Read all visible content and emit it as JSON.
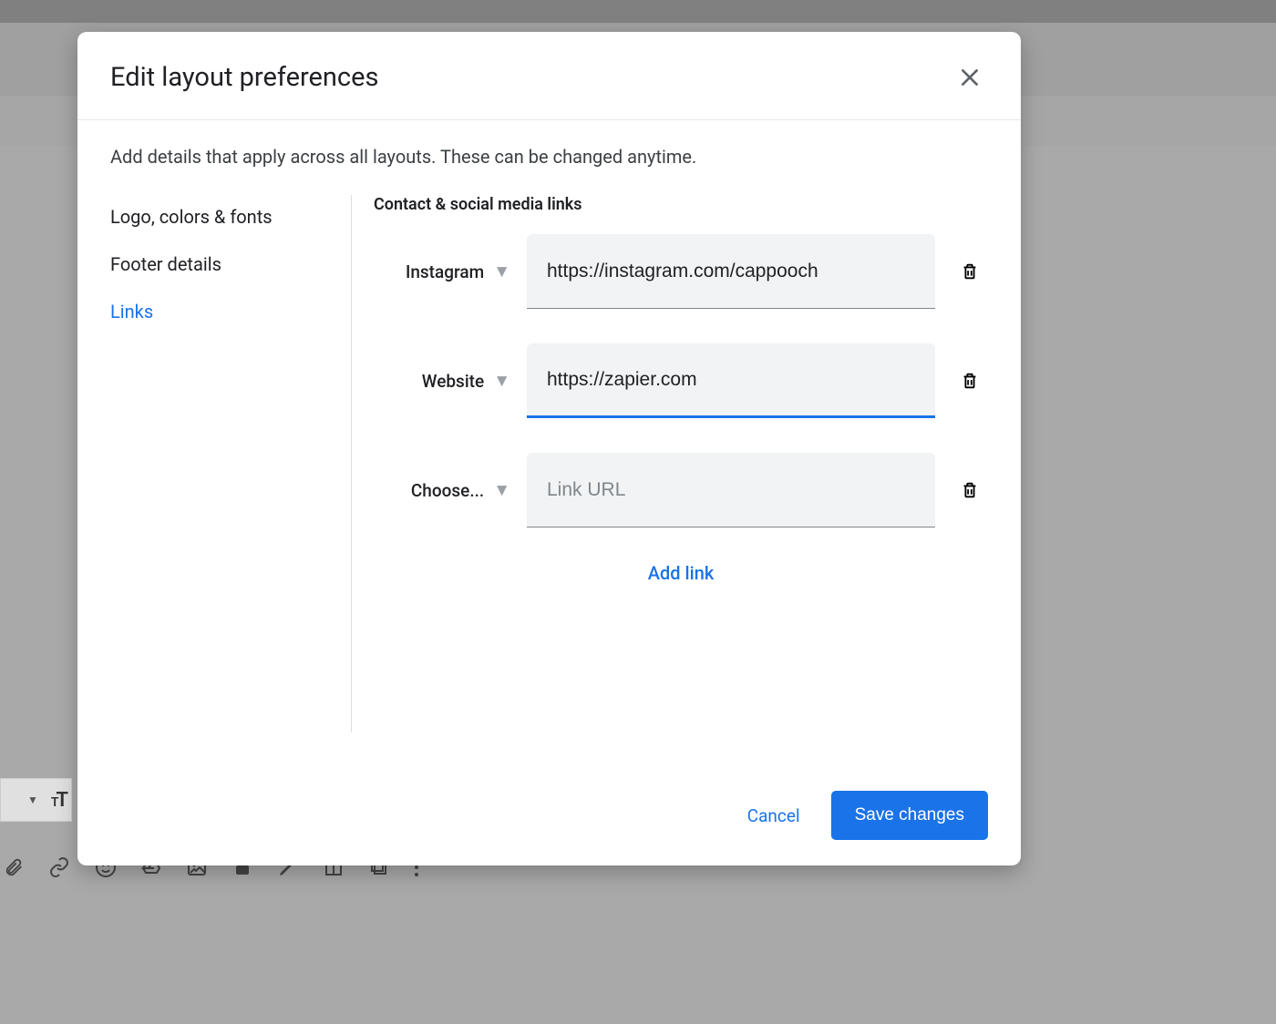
{
  "modal": {
    "title": "Edit layout preferences",
    "description": "Add details that apply across all layouts. These can be changed anytime.",
    "nav": [
      {
        "label": "Logo, colors & fonts"
      },
      {
        "label": "Footer details"
      },
      {
        "label": "Links"
      }
    ],
    "section_title": "Contact & social media links",
    "links": [
      {
        "type": "Instagram",
        "url": "https://instagram.com/cappooch",
        "focused": false
      },
      {
        "type": "Website",
        "url": "https://zapier.com",
        "focused": true
      },
      {
        "type": "Choose...",
        "url": "",
        "placeholder": "Link URL",
        "focused": false
      }
    ],
    "add_link_label": "Add link",
    "cancel_label": "Cancel",
    "save_label": "Save changes"
  }
}
